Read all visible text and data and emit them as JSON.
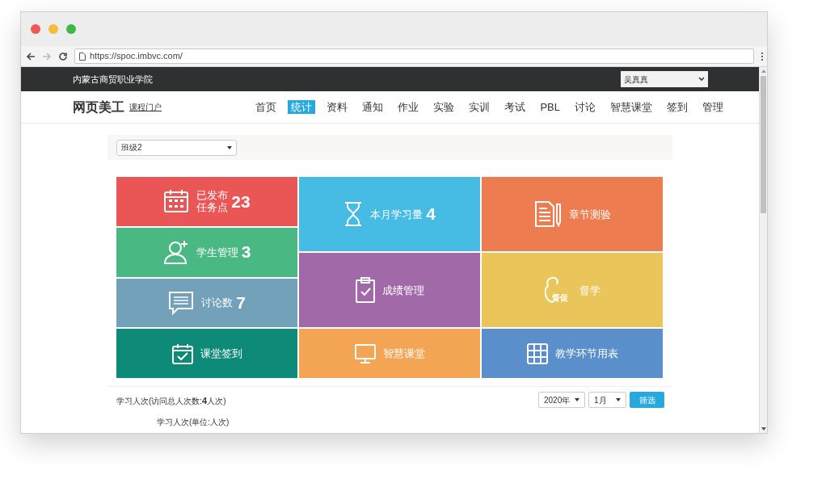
{
  "browser": {
    "url": "https://spoc.imbvc.com/"
  },
  "topbar": {
    "school": "内蒙古商贸职业学院",
    "user_select": "吴真真"
  },
  "header": {
    "course": "网页美工",
    "portal_link": "课程门户"
  },
  "nav": [
    {
      "label": "首页",
      "selected": false
    },
    {
      "label": "统计",
      "selected": true
    },
    {
      "label": "资料",
      "selected": false
    },
    {
      "label": "通知",
      "selected": false
    },
    {
      "label": "作业",
      "selected": false
    },
    {
      "label": "实验",
      "selected": false
    },
    {
      "label": "实训",
      "selected": false
    },
    {
      "label": "考试",
      "selected": false
    },
    {
      "label": "PBL",
      "selected": false
    },
    {
      "label": "讨论",
      "selected": false
    },
    {
      "label": "智慧课堂",
      "selected": false
    },
    {
      "label": "签到",
      "selected": false
    },
    {
      "label": "管理",
      "selected": false
    }
  ],
  "class_select": "班级2",
  "tile_columns": [
    [
      {
        "label_lines": [
          "已发布",
          "任务点"
        ],
        "count": "23",
        "color": "#e95655"
      },
      {
        "label_lines": [
          "学生管理"
        ],
        "count": "3",
        "color": "#4ab883"
      },
      {
        "label_lines": [
          "讨论数"
        ],
        "count": "7",
        "color": "#72a1b9"
      },
      {
        "label_lines": [
          "课堂签到"
        ],
        "color": "#0e8a78"
      }
    ],
    [
      {
        "label_lines": [
          "本月学习量"
        ],
        "count": "4",
        "color": "#46bbe4"
      },
      {
        "label_lines": [
          "成绩管理"
        ],
        "color": "#a269a8"
      },
      {
        "label_lines": [
          "智慧课堂"
        ],
        "color": "#f3a553"
      }
    ],
    [
      {
        "label_lines": [
          "章节测验"
        ],
        "color": "#ee7c51"
      },
      {
        "icon_text": "督促",
        "label_lines": [
          "督学"
        ],
        "color": "#eac65a"
      },
      {
        "label_lines": [
          "教学环节用表"
        ],
        "color": "#5b8fcb"
      }
    ]
  ],
  "stats": {
    "caption_prefix": "学习人次(访问总人次数:",
    "total": "4",
    "caption_suffix": "人次)",
    "year": "2020年",
    "month": "1月",
    "filter_button": "筛选",
    "chart_title": "学习人次(单位:人次)"
  }
}
